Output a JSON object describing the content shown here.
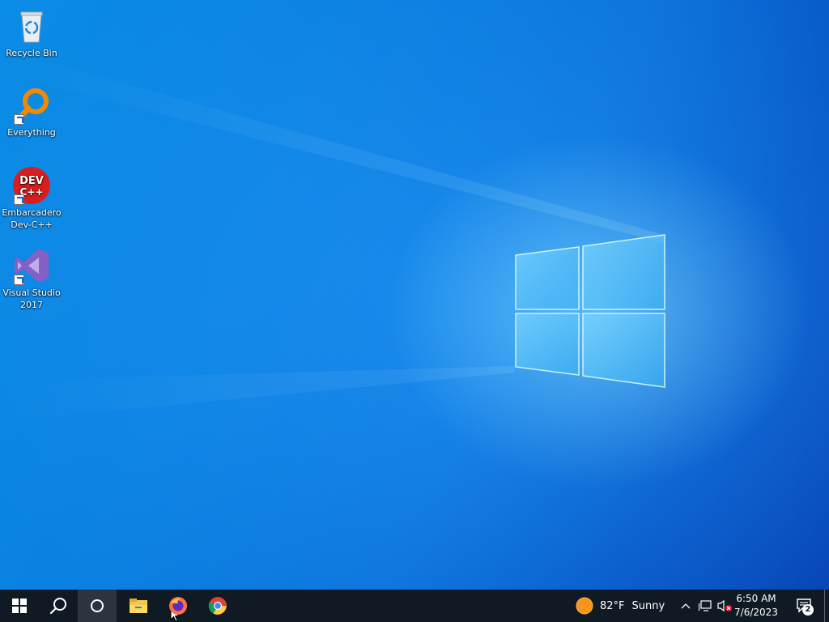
{
  "desktop_icons": [
    {
      "label": "Recycle Bin",
      "icon": "recycle-bin-icon"
    },
    {
      "label": "Everything",
      "icon": "everything-search-icon"
    },
    {
      "label": "Embarcadero Dev-C++",
      "icon": "dev-cpp-icon",
      "badge": "DEV C++"
    },
    {
      "label": "Visual Studio 2017",
      "icon": "visual-studio-icon"
    }
  ],
  "taskbar": {
    "start": "windows-start-icon",
    "search": "search-icon",
    "cortana": "cortana-icon",
    "pinned": [
      "file-explorer-icon",
      "firefox-icon",
      "chrome-icon"
    ],
    "weather": {
      "temp": "82°F",
      "condition": "Sunny",
      "icon": "sun-icon"
    },
    "tray_icons": [
      "show-hidden-icons-chevron",
      "network-icon",
      "volume-muted-icon"
    ],
    "time": "6:50 AM",
    "date": "7/6/2023",
    "notifications_count": "2"
  },
  "colors": {
    "taskbar": "#101a24",
    "wallpaper_accent": "#0a7fe0"
  }
}
